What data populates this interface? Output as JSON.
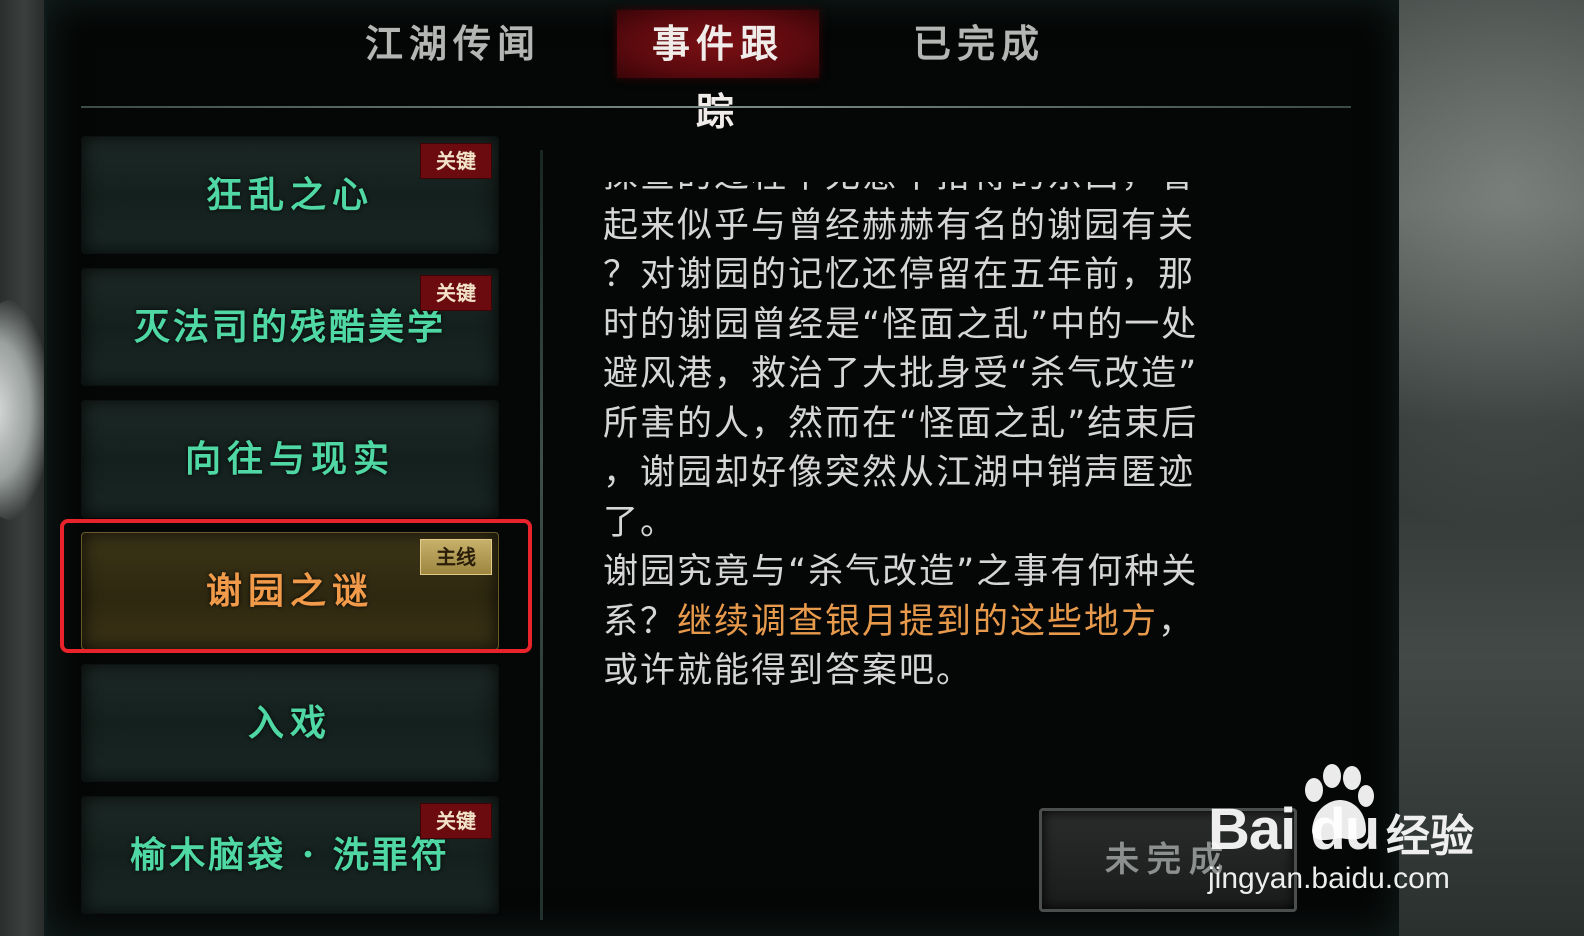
{
  "tabs": [
    {
      "label": "江湖传闻"
    },
    {
      "label": "事件跟踪"
    },
    {
      "label": "已完成"
    }
  ],
  "active_tab_index": 1,
  "quests": [
    {
      "label": "狂乱之心",
      "tag": "关键"
    },
    {
      "label": "灭法司的残酷美学",
      "tag": "关键"
    },
    {
      "label": "向往与现实",
      "tag": ""
    },
    {
      "label": "谢园之谜",
      "tag": "主线"
    },
    {
      "label": "入戏",
      "tag": ""
    },
    {
      "label": "榆木脑袋 · 洗罪符",
      "tag": "关键"
    }
  ],
  "selected_quest_index": 3,
  "description": {
    "line0": "探查的过程中无意中拾得的东西，看",
    "line1": "起来似乎与曾经赫赫有名的谢园有关",
    "line2": "？对谢园的记忆还停留在五年前，那",
    "line3": "时的谢园曾经是“怪面之乱”中的一处",
    "line4": "避风港，救治了大批身受“杀气改造”",
    "line5": "所害的人，然而在“怪面之乱”结束后",
    "line6": "，谢园却好像突然从江湖中销声匿迹",
    "line7": "了。",
    "line8": "谢园究竟与“杀气改造”之事有何种关",
    "line9_a": "系？",
    "line9_b": "继续调查银月提到的这些地方",
    "line9_c": "，",
    "line10": "或许就能得到答案吧。"
  },
  "status_button": {
    "label": "未完成"
  },
  "watermark": {
    "brand": "Bai du",
    "product": "经验",
    "url": "jingyan.baidu.com"
  },
  "colors": {
    "active_tab": "#7a0f14",
    "quest_text": "#4fd7a4",
    "selected_quest_text": "#f09a4a",
    "highlight_text": "#e79a4c",
    "selection_frame": "#e8232b"
  }
}
